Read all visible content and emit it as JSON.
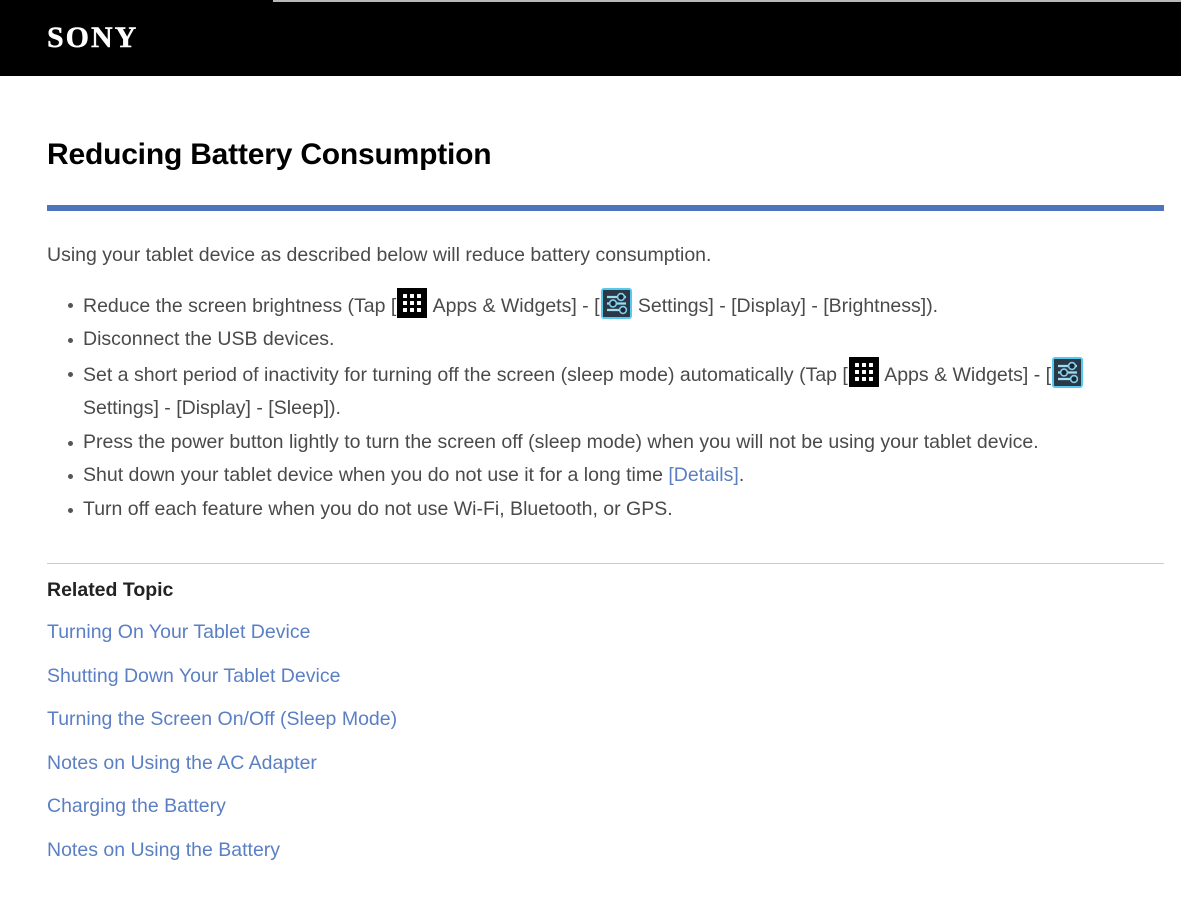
{
  "header": {
    "brand": "SONY",
    "brand_icon": "sony-logo"
  },
  "page": {
    "title": "Reducing Battery Consumption",
    "intro": "Using your tablet device as described below will reduce battery consumption."
  },
  "icons": {
    "apps_widgets": "apps-grid-icon",
    "settings": "settings-sliders-icon"
  },
  "tips": {
    "item1": {
      "part1": "Reduce the screen brightness (Tap [",
      "part2": " Apps & Widgets] - [",
      "part3": " Settings] - [Display] - [Brightness])."
    },
    "item2": {
      "text": "Disconnect the USB devices."
    },
    "item3": {
      "part1": "Set a short period of inactivity for turning off the screen (sleep mode) automatically (Tap [",
      "part2": " Apps & Widgets] - [",
      "part3": " Settings] - [Display] - [Sleep])."
    },
    "item4": {
      "text": "Press the power button lightly to turn the screen off (sleep mode) when you will not be using your tablet device."
    },
    "item5": {
      "part1": "Shut down your tablet device when you do not use it for a long time ",
      "link": "[Details]",
      "part2": "."
    },
    "item6": {
      "text": "Turn off each feature when you do not use Wi-Fi, Bluetooth, or GPS."
    }
  },
  "related": {
    "heading": "Related Topic",
    "links": [
      {
        "label": "Turning On Your Tablet Device"
      },
      {
        "label": "Shutting Down Your Tablet Device"
      },
      {
        "label": "Turning the Screen On/Off (Sleep Mode)"
      },
      {
        "label": "Notes on Using the AC Adapter"
      },
      {
        "label": "Charging the Battery"
      },
      {
        "label": "Notes on Using the Battery"
      }
    ]
  },
  "colors": {
    "header_bg": "#000000",
    "title_rule": "#4d74bc",
    "link": "#5a7fc4",
    "body_text": "#4a4a4a",
    "section_rule": "#cccccc",
    "settings_icon_border": "#55c9ef",
    "settings_icon_bg": "#232d38"
  }
}
